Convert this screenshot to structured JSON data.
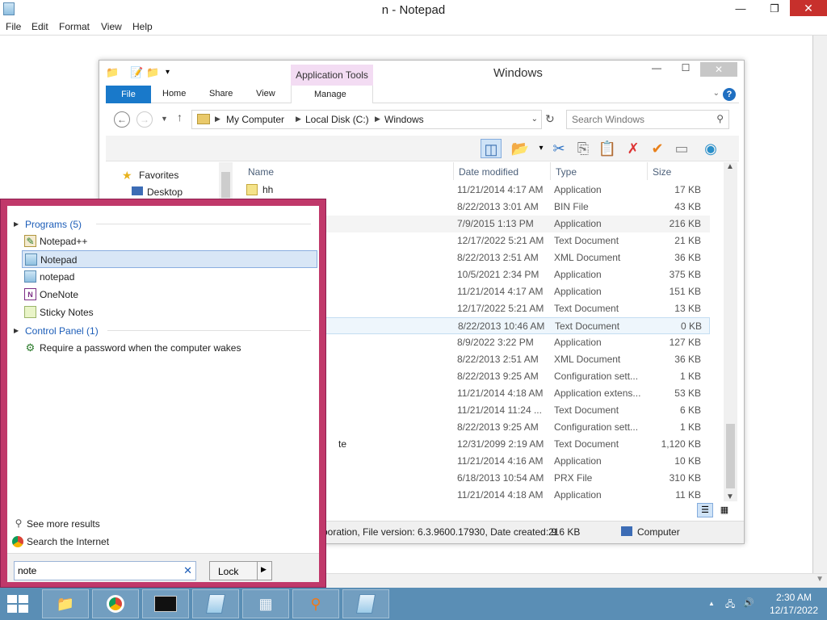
{
  "notepad": {
    "title": "n - Notepad",
    "menu": [
      "File",
      "Edit",
      "Format",
      "View",
      "Help"
    ],
    "buttons": {
      "minimize": "—",
      "maximize": "❐",
      "close": "✕"
    }
  },
  "explorer": {
    "title": "Windows",
    "app_tools": "Application Tools",
    "tabs": {
      "file": "File",
      "home": "Home",
      "share": "Share",
      "view": "View",
      "manage": "Manage"
    },
    "help": "?",
    "breadcrumb": [
      "My Computer",
      "Local Disk (C:)",
      "Windows"
    ],
    "search_placeholder": "Search Windows",
    "nav": {
      "favorites": "Favorites",
      "desktop": "Desktop"
    },
    "columns": {
      "name": "Name",
      "date": "Date modified",
      "type": "Type",
      "size": "Size"
    },
    "rows": [
      {
        "name": "hh",
        "date": "11/21/2014 4:17 AM",
        "type": "Application",
        "size": "17 KB"
      },
      {
        "name": "",
        "date": "8/22/2013 3:01 AM",
        "type": "BIN File",
        "size": "43 KB"
      },
      {
        "name": "",
        "date": "7/9/2015 1:13 PM",
        "type": "Application",
        "size": "216 KB"
      },
      {
        "name": "",
        "date": "12/17/2022 5:21 AM",
        "type": "Text Document",
        "size": "21 KB"
      },
      {
        "name": "",
        "date": "8/22/2013 2:51 AM",
        "type": "XML Document",
        "size": "36 KB"
      },
      {
        "name": "",
        "date": "10/5/2021 2:34 PM",
        "type": "Application",
        "size": "375 KB"
      },
      {
        "name": "",
        "date": "11/21/2014 4:17 AM",
        "type": "Application",
        "size": "151 KB"
      },
      {
        "name": "",
        "date": "12/17/2022 5:21 AM",
        "type": "Text Document",
        "size": "13 KB"
      },
      {
        "name": "",
        "date": "8/22/2013 10:46 AM",
        "type": "Text Document",
        "size": "0 KB"
      },
      {
        "name": "",
        "date": "8/9/2022 3:22 PM",
        "type": "Application",
        "size": "127 KB"
      },
      {
        "name": "",
        "date": "8/22/2013 2:51 AM",
        "type": "XML Document",
        "size": "36 KB"
      },
      {
        "name": "",
        "date": "8/22/2013 9:25 AM",
        "type": "Configuration sett...",
        "size": "1 KB"
      },
      {
        "name": "",
        "date": "11/21/2014 4:18 AM",
        "type": "Application extens...",
        "size": "53 KB"
      },
      {
        "name": "",
        "date": "11/21/2014 11:24 ...",
        "type": "Text Document",
        "size": "6 KB"
      },
      {
        "name": "",
        "date": "8/22/2013 9:25 AM",
        "type": "Configuration sett...",
        "size": "1 KB"
      },
      {
        "name": "te",
        "date": "12/31/2099 2:19 AM",
        "type": "Text Document",
        "size": "1,120 KB"
      },
      {
        "name": "",
        "date": "11/21/2014 4:16 AM",
        "type": "Application",
        "size": "10 KB"
      },
      {
        "name": "",
        "date": "6/18/2013 10:54 AM",
        "type": "PRX File",
        "size": "310 KB"
      },
      {
        "name": "",
        "date": "11/21/2014 4:18 AM",
        "type": "Application",
        "size": "11 KB"
      }
    ],
    "status": {
      "details": "rporation, File version: 6.3.9600.17930, Date created: 9",
      "size": "216 KB",
      "location": "Computer"
    }
  },
  "start_search": {
    "programs_header": "Programs (5)",
    "programs": [
      "Notepad++",
      "Notepad",
      "notepad",
      "OneNote",
      "Sticky Notes"
    ],
    "control_panel_header": "Control Panel (1)",
    "control_panel_items": [
      "Require a password when the computer wakes"
    ],
    "see_more": "See more results",
    "search_internet": "Search the Internet",
    "query": "note",
    "clear": "✕",
    "lock_label": "Lock"
  },
  "taskbar": {
    "time": "2:30 AM",
    "date": "12/17/2022"
  }
}
